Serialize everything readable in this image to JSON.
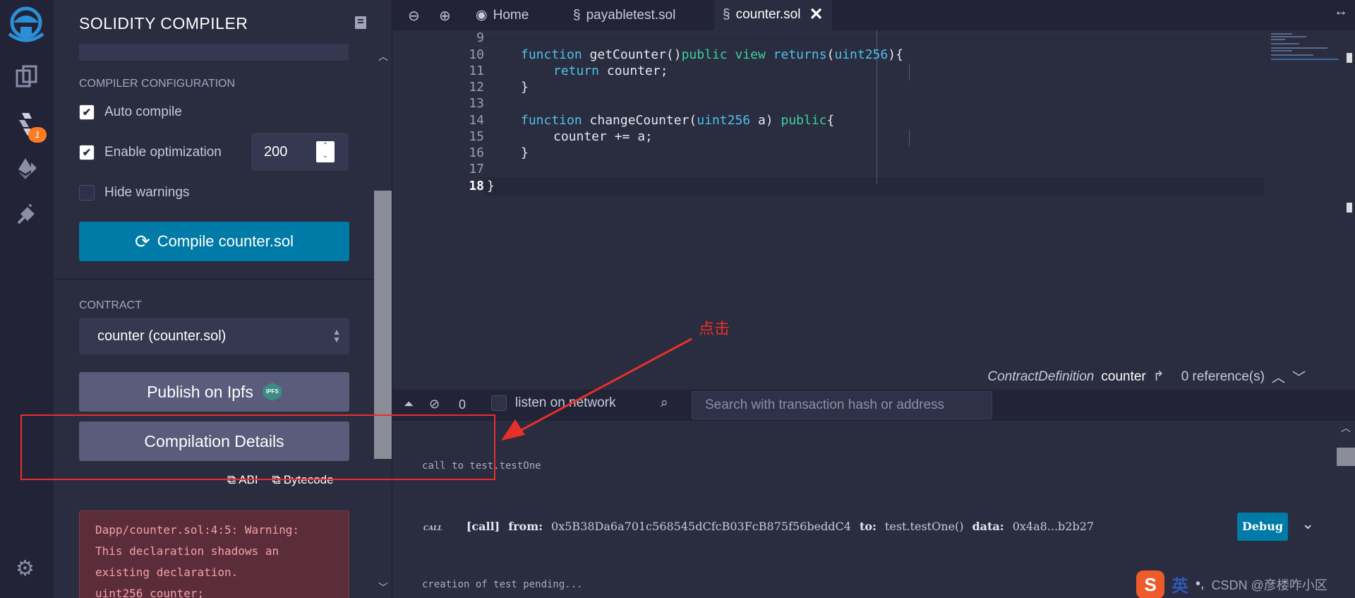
{
  "panel": {
    "title": "SOLIDITY COMPILER",
    "config_label": "COMPILER CONFIGURATION",
    "auto_compile": "Auto compile",
    "enable_optimization": "Enable optimization",
    "runs": "200",
    "hide_warnings": "Hide warnings",
    "compile_button": "Compile counter.sol",
    "contract_label": "CONTRACT",
    "contract_selected": "counter (counter.sol)",
    "publish_button": "Publish on Ipfs",
    "ipfs_badge": "IPFS",
    "details_button": "Compilation Details",
    "abi_link": "ABI",
    "bytecode_link": "Bytecode",
    "warning_text": "Dapp/counter.sol:4:5: Warning:\nThis declaration shadows an\nexisting declaration.\nuint256 counter;",
    "plugin_badge": "1"
  },
  "tabs": {
    "home": "Home",
    "payabletest": "payabletest.sol",
    "counter": "counter.sol"
  },
  "editor": {
    "line_numbers": [
      "9",
      "10",
      "11",
      "12",
      "13",
      "14",
      "15",
      "16",
      "17",
      "18"
    ],
    "lines": {
      "l10_fn": "function",
      "l10_name": " getCounter()",
      "l10_pub": "public",
      "l10_view": "view",
      "l10_ret": "returns",
      "l10_open": "(",
      "l10_type": "uint256",
      "l10_close": "){",
      "l11_ret": "return",
      "l11_rest": " counter;",
      "l12": "}",
      "l14_fn": "function",
      "l14_name": " changeCounter(",
      "l14_type": "uint256",
      "l14_arg": " a) ",
      "l14_pub": "public",
      "l14_brace": "{",
      "l15": "counter += a;",
      "l16": "}",
      "l18": "}"
    },
    "contract_def_type": "ContractDefinition",
    "contract_def_name": "counter",
    "references": "0 reference(s)"
  },
  "terminal": {
    "pending_count": "0",
    "listen_label": "listen on network",
    "search_placeholder": "Search with transaction hash or address",
    "line1": "call to test.testOne",
    "call_tag": "CALL",
    "call_label": "[call]",
    "from_label": "from:",
    "from_value": "0x5B38Da6a701c568545dCfcB03FcB875f56beddC4",
    "to_label": "to:",
    "to_value": "test.testOne()",
    "data_label": "data:",
    "data_value": "0x4a8...b2b27",
    "debug_button": "Debug",
    "line3": "creation of test pending..."
  },
  "annotation": {
    "label": "点击"
  },
  "watermark": {
    "ime_logo": "S",
    "ime_lang": "英",
    "ime_symbol": "•,",
    "text": "CSDN @彦楼咋小区"
  },
  "colors": {
    "accent": "#007aa6",
    "annotation": "#e8302a",
    "badge": "#ff7b22"
  }
}
